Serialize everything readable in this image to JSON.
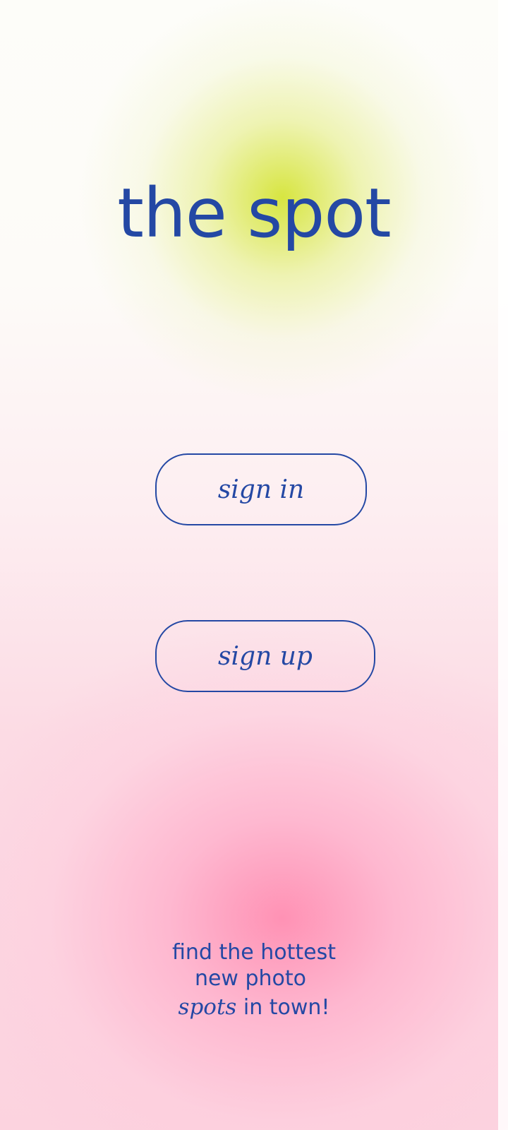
{
  "app": {
    "title": "the spot"
  },
  "auth": {
    "sign_in_label": "sign in",
    "sign_up_label": "sign up"
  },
  "tagline": {
    "line1": "find the hottest",
    "line2": "new photo",
    "line3_emphasis": "spots",
    "line3_rest": " in town!"
  },
  "colors": {
    "accent": "#2448a4",
    "glow_top": "#d5e437",
    "glow_bottom": "#ff8eb2"
  }
}
